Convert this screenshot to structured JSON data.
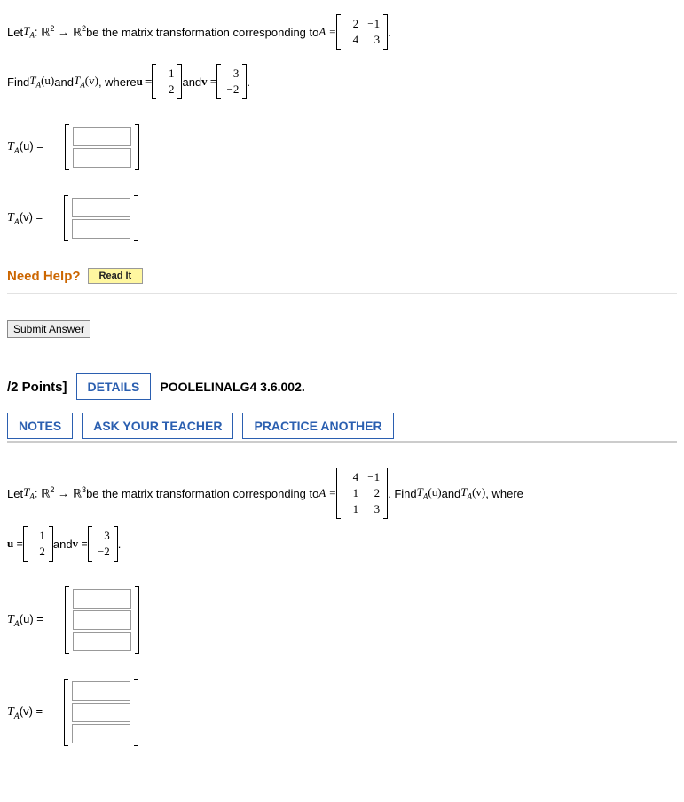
{
  "q1": {
    "intro_prefix": "Let ",
    "T": "T",
    "Tsub": "A",
    "map": ": ℝ",
    "exp2": "2",
    "arrow": " → ℝ",
    "body": " be the matrix transformation corresponding to ",
    "Aeq": "A = ",
    "matrixA": [
      [
        "2",
        "−1"
      ],
      [
        "4",
        "3"
      ]
    ],
    "find_prefix": "Find ",
    "paren_u": "(u)",
    "and_text": " and ",
    "paren_v": "(v)",
    "where_u": ", where ",
    "u_eq": "u = ",
    "vec_u": [
      "1",
      "2"
    ],
    "and_v": " and ",
    "v_eq": "v = ",
    "vec_v": [
      "3",
      "−2"
    ],
    "period": ".",
    "tau_label": "(u)  =",
    "tav_label": "(v)  =",
    "need_help": "Need Help?",
    "read_it": "Read It",
    "submit": "Submit Answer"
  },
  "q2": {
    "points": "/2 Points]",
    "details": "DETAILS",
    "source": "POOLELINALG4 3.6.002.",
    "notes": "NOTES",
    "ask": "ASK YOUR TEACHER",
    "practice": "PRACTICE ANOTHER",
    "intro_prefix": "Let ",
    "map": ": ℝ",
    "exp2": "2",
    "arrow": " → ℝ",
    "exp3": "3",
    "body": " be the matrix transformation corresponding to ",
    "Aeq": "A = ",
    "matrixA": [
      [
        "4",
        "−1"
      ],
      [
        "1",
        "2"
      ],
      [
        "1",
        "3"
      ]
    ],
    "find_suffix": ". Find ",
    "paren_u": "(u)",
    "and_text": " and ",
    "paren_v": "(v)",
    "where_suffix": ", where",
    "u_eq": "u = ",
    "vec_u": [
      "1",
      "2"
    ],
    "and_v": " and ",
    "v_eq": "v = ",
    "vec_v": [
      "3",
      "−2"
    ],
    "period": ".",
    "tau_label": "(u)  =",
    "tav_label": "(v)  ="
  }
}
